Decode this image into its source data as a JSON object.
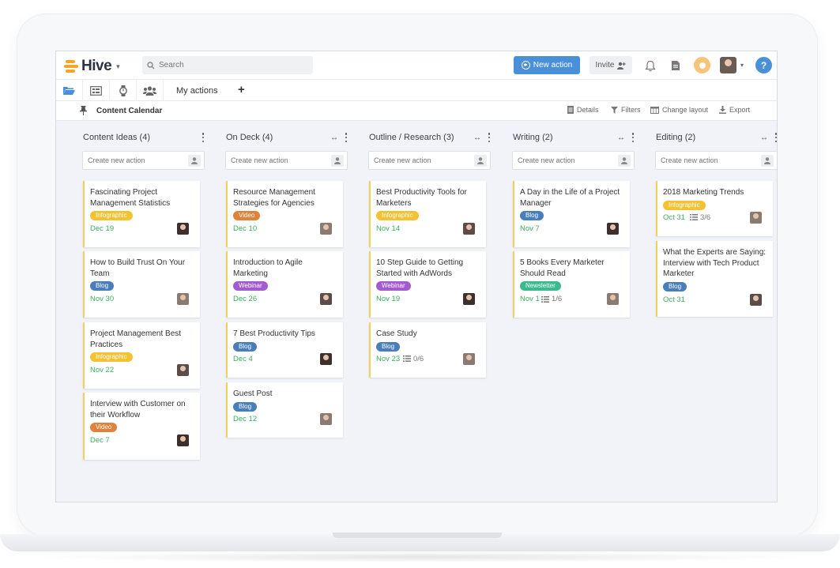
{
  "app": {
    "name": "Hive"
  },
  "header": {
    "search_placeholder": "Search",
    "new_action_label": "New action",
    "invite_label": "Invite",
    "help_label": "?"
  },
  "tabs": {
    "my_actions_label": "My actions",
    "add_label": "+"
  },
  "subbar": {
    "board_title": "Content Calendar",
    "details_label": "Details",
    "filters_label": "Filters",
    "change_layout_label": "Change layout",
    "export_label": "Export"
  },
  "create_placeholder": "Create new action",
  "tag_colors": {
    "Infographic": "#f1c232",
    "Blog": "#4a7ebb",
    "Video": "#e0813c",
    "Webinar": "#a35bd0",
    "Newsletter": "#3bba8f"
  },
  "columns": [
    {
      "title": "Content Ideas (4)",
      "cards": [
        {
          "title": "Fascinating Project Management Statistics",
          "tag": "Infographic",
          "date": "Dec 19"
        },
        {
          "title": "How to Build Trust On Your Team",
          "tag": "Blog",
          "date": "Nov 30"
        },
        {
          "title": "Project Management Best Practices",
          "tag": "Infographic",
          "date": "Nov 22"
        },
        {
          "title": "Interview with Customer on their Workflow",
          "tag": "Video",
          "date": "Dec 7"
        }
      ]
    },
    {
      "title": "On Deck (4)",
      "cards": [
        {
          "title": "Resource Management Strategies for Agencies",
          "tag": "Video",
          "date": "Dec 10"
        },
        {
          "title": "Introduction to Agile Marketing",
          "tag": "Webinar",
          "date": "Dec 26"
        },
        {
          "title": "7 Best Productivity Tips",
          "tag": "Blog",
          "date": "Dec 4"
        },
        {
          "title": "Guest Post",
          "tag": "Blog",
          "date": "Dec 12"
        }
      ]
    },
    {
      "title": "Outline / Research (3)",
      "cards": [
        {
          "title": "Best Productivity Tools for Marketers",
          "tag": "Infographic",
          "date": "Nov 14"
        },
        {
          "title": "10 Step Guide to Getting Started with AdWords",
          "tag": "Webinar",
          "date": "Nov 19"
        },
        {
          "title": "Case Study",
          "tag": "Blog",
          "date": "Nov 23",
          "checklist": "0/6"
        }
      ]
    },
    {
      "title": "Writing (2)",
      "cards": [
        {
          "title": "A Day in the Life of a Project Manager",
          "tag": "Blog",
          "date": "Nov 7"
        },
        {
          "title": "5 Books Every Marketer Should Read",
          "tag": "Newsletter",
          "date": "Nov 1",
          "checklist": "1/6"
        }
      ]
    },
    {
      "title": "Editing (2)",
      "cards": [
        {
          "title": "2018 Marketing Trends",
          "tag": "Infographic",
          "date": "Oct 31",
          "checklist": "3/6"
        },
        {
          "title": "What the Experts are Saying: Interview with Tech Product Marketer",
          "tag": "Blog",
          "date": "Oct 31"
        }
      ]
    }
  ]
}
